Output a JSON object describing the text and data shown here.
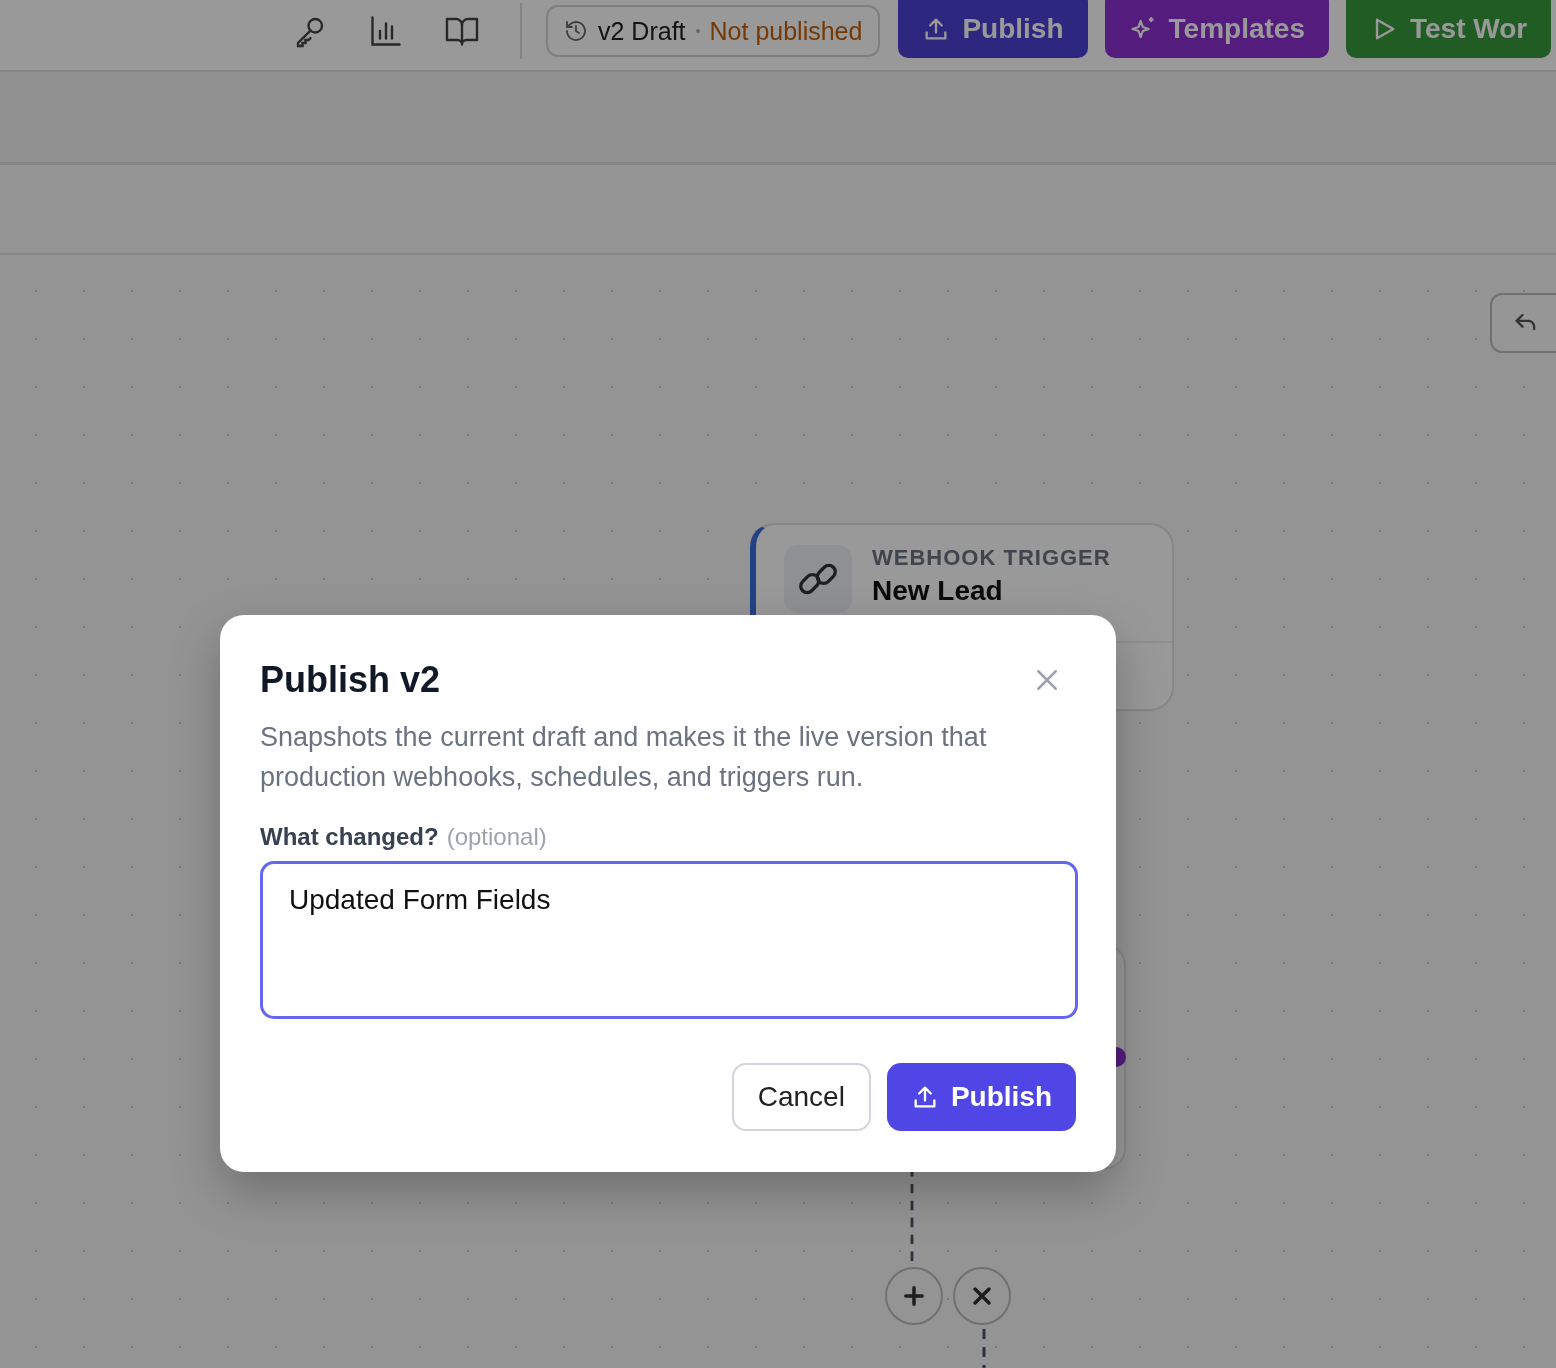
{
  "toolbar": {
    "version": {
      "label": "v2 Draft",
      "status": "Not published"
    },
    "buttons": [
      {
        "label": "Publish",
        "kind": "publish"
      },
      {
        "label": "Templates",
        "kind": "templates"
      },
      {
        "label": "Test Wor",
        "kind": "test"
      }
    ]
  },
  "canvas": {
    "node": {
      "type": "WEBHOOK TRIGGER",
      "title": "New Lead"
    }
  },
  "dialog": {
    "title": "Publish v2",
    "description": "Snapshots the current draft and makes it the live version that production webhooks, schedules, and triggers run.",
    "field_label": "What changed?",
    "field_hint": "(optional)",
    "value": "Updated Form Fields",
    "buttons": [
      {
        "label": "Cancel",
        "kind": "secondary"
      },
      {
        "label": "Publish",
        "kind": "primary"
      }
    ]
  }
}
